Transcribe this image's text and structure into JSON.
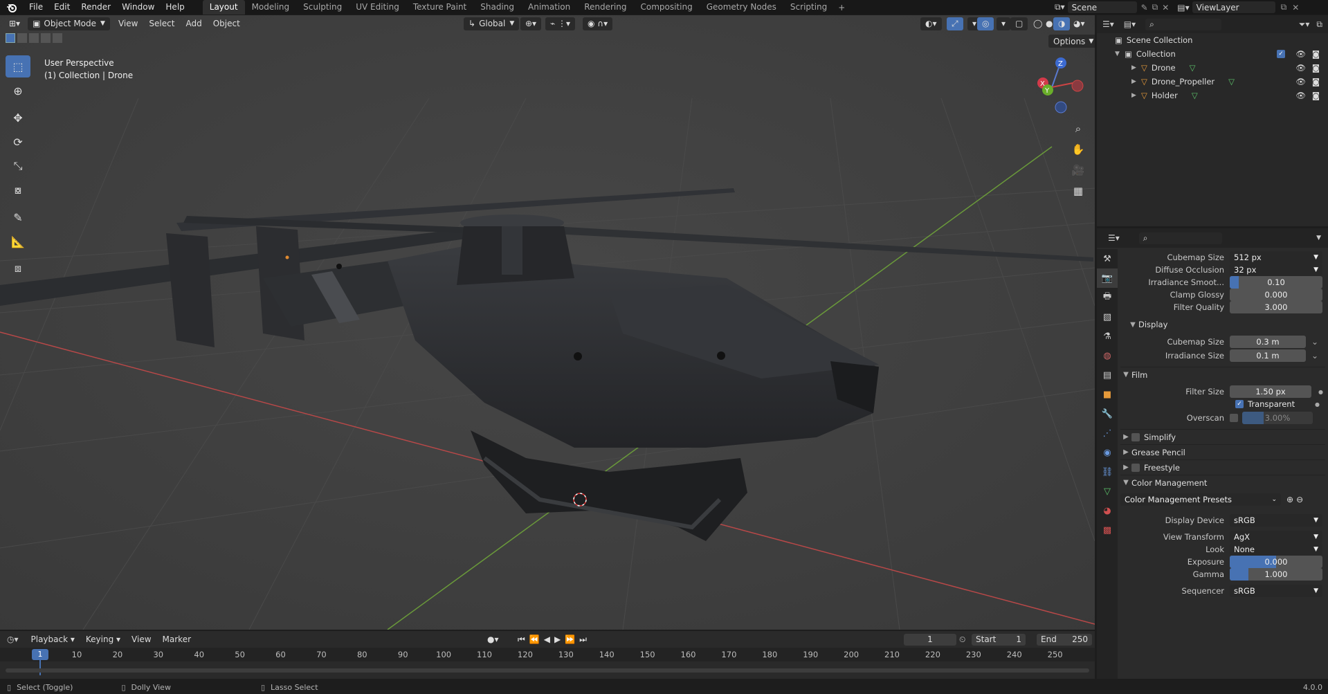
{
  "topbar": {
    "menus": [
      "File",
      "Edit",
      "Render",
      "Window",
      "Help"
    ],
    "workspaces": [
      "Layout",
      "Modeling",
      "Sculpting",
      "UV Editing",
      "Texture Paint",
      "Shading",
      "Animation",
      "Rendering",
      "Compositing",
      "Geometry Nodes",
      "Scripting"
    ],
    "add_tab": "+",
    "scene_label": "Scene",
    "view_layer_label": "ViewLayer"
  },
  "viewport": {
    "mode": "Object Mode",
    "menus": [
      "View",
      "Select",
      "Add",
      "Object"
    ],
    "transform_orientation": "Global",
    "options_label": "Options",
    "info_line1": "User Perspective",
    "info_line2": "(1) Collection | Drone",
    "gizmo_x": "X",
    "gizmo_y": "Y",
    "gizmo_z": "Z"
  },
  "outliner": {
    "scene_collection": "Scene Collection",
    "collection": "Collection",
    "objects": [
      "Drone",
      "Drone_Propeller",
      "Holder"
    ]
  },
  "properties": {
    "cubemap_size_label": "Cubemap Size",
    "cubemap_size_value": "512 px",
    "diffuse_occlusion_label": "Diffuse Occlusion",
    "diffuse_occlusion_value": "32 px",
    "irradiance_smooth_label": "Irradiance Smoot...",
    "irradiance_smooth_value": "0.10",
    "clamp_glossy_label": "Clamp Glossy",
    "clamp_glossy_value": "0.000",
    "filter_quality_label": "Filter Quality",
    "filter_quality_value": "3.000",
    "display_panel": "Display",
    "display_cubemap_label": "Cubemap Size",
    "display_cubemap_value": "0.3 m",
    "display_irradiance_label": "Irradiance Size",
    "display_irradiance_value": "0.1 m",
    "film_panel": "Film",
    "filter_size_label": "Filter Size",
    "filter_size_value": "1.50 px",
    "transparent_label": "Transparent",
    "overscan_label": "Overscan",
    "overscan_value": "3.00%",
    "simplify_panel": "Simplify",
    "grease_pencil_panel": "Grease Pencil",
    "freestyle_panel": "Freestyle",
    "color_management_panel": "Color Management",
    "cm_presets": "Color Management Presets",
    "display_device_label": "Display Device",
    "display_device_value": "sRGB",
    "view_transform_label": "View Transform",
    "view_transform_value": "AgX",
    "look_label": "Look",
    "look_value": "None",
    "exposure_label": "Exposure",
    "exposure_value": "0.000",
    "gamma_label": "Gamma",
    "gamma_value": "1.000",
    "sequencer_label": "Sequencer",
    "sequencer_value": "sRGB"
  },
  "timeline": {
    "menus": [
      "Playback",
      "Keying",
      "View",
      "Marker"
    ],
    "current_frame": "1",
    "start_label": "Start",
    "start_value": "1",
    "end_label": "End",
    "end_value": "250",
    "playhead": "1",
    "ticks": [
      "10",
      "20",
      "30",
      "40",
      "50",
      "60",
      "70",
      "80",
      "90",
      "100",
      "110",
      "120",
      "130",
      "140",
      "150",
      "160",
      "170",
      "180",
      "190",
      "200",
      "210",
      "220",
      "230",
      "240",
      "250"
    ]
  },
  "status": {
    "select_hint": "Select (Toggle)",
    "dolly_hint": "Dolly View",
    "lasso_hint": "Lasso Select",
    "version": "4.0.0"
  },
  "colors": {
    "accent": "#4772b3",
    "grid_red": "#b84848",
    "grid_green": "#6a9a3a"
  }
}
